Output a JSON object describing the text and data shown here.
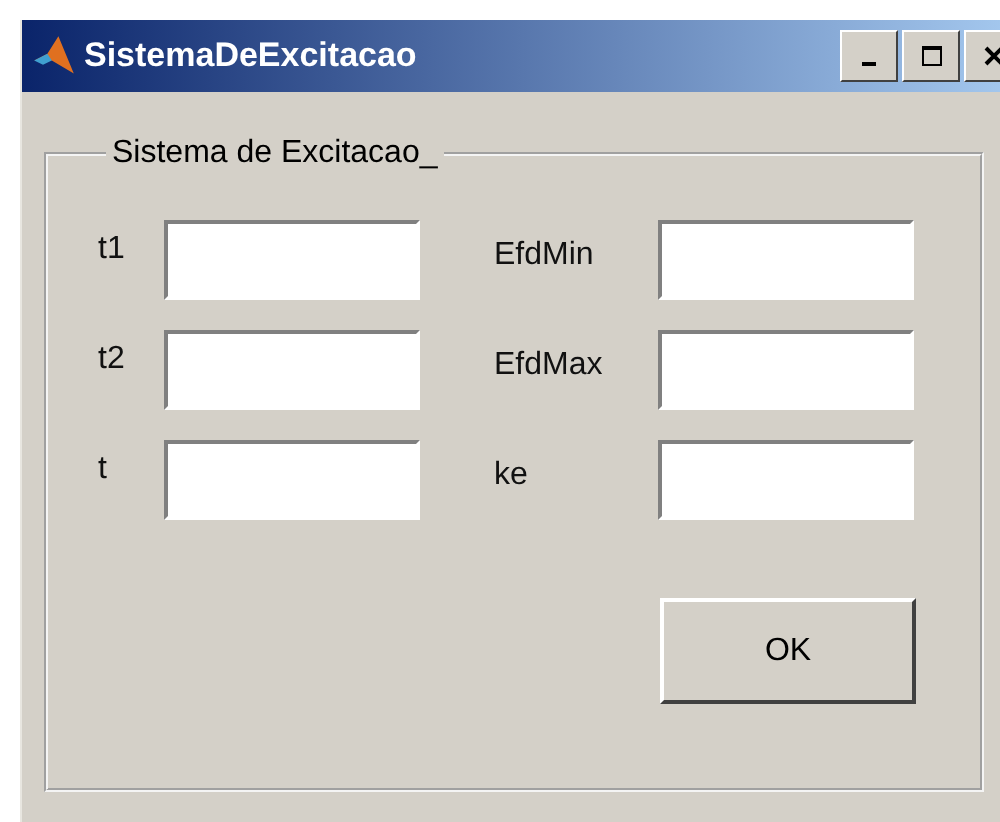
{
  "window": {
    "title": "SistemaDeExcitacao"
  },
  "panel": {
    "title": "Sistema de Excitacao_"
  },
  "left_fields": [
    {
      "label": "t1"
    },
    {
      "label": "t2"
    },
    {
      "label": "t"
    }
  ],
  "right_fields": [
    {
      "label": "EfdMin"
    },
    {
      "label": "EfdMax"
    },
    {
      "label": "ke"
    }
  ],
  "buttons": [
    "OK"
  ]
}
